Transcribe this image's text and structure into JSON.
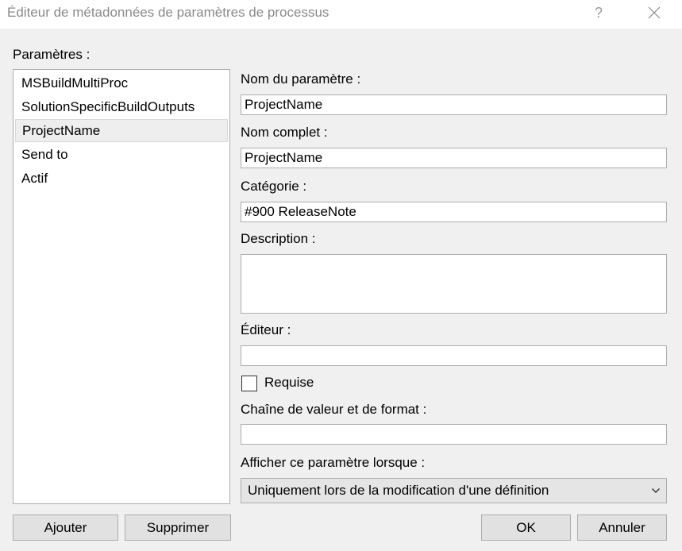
{
  "window": {
    "title": "Éditeur de métadonnées de paramètres de processus",
    "help_glyph": "?"
  },
  "parameters_list": {
    "label": "Paramètres :",
    "items": [
      {
        "label": "MSBuildMultiProc",
        "selected": false
      },
      {
        "label": "SolutionSpecificBuildOutputs",
        "selected": false
      },
      {
        "label": "ProjectName",
        "selected": true
      },
      {
        "label": "Send to",
        "selected": false
      },
      {
        "label": "Actif",
        "selected": false
      }
    ]
  },
  "form": {
    "name_label": "Nom du paramètre :",
    "name_value": "ProjectName",
    "fullname_label": "Nom complet :",
    "fullname_value": "ProjectName",
    "category_label": "Catégorie :",
    "category_value": "#900 ReleaseNote",
    "description_label": "Description :",
    "description_value": "",
    "editor_label": "Éditeur :",
    "editor_value": "",
    "required_label": "Requise",
    "required_checked": false,
    "format_label": "Chaîne de valeur et de format :",
    "format_value": "",
    "display_label": "Afficher ce paramètre lorsque :",
    "display_value": "Uniquement lors de la modification d'une définition"
  },
  "buttons": {
    "add": "Ajouter",
    "remove": "Supprimer",
    "ok": "OK",
    "cancel": "Annuler"
  },
  "icons": {
    "close": "close-icon",
    "dropdown": "chevron-down-icon"
  }
}
